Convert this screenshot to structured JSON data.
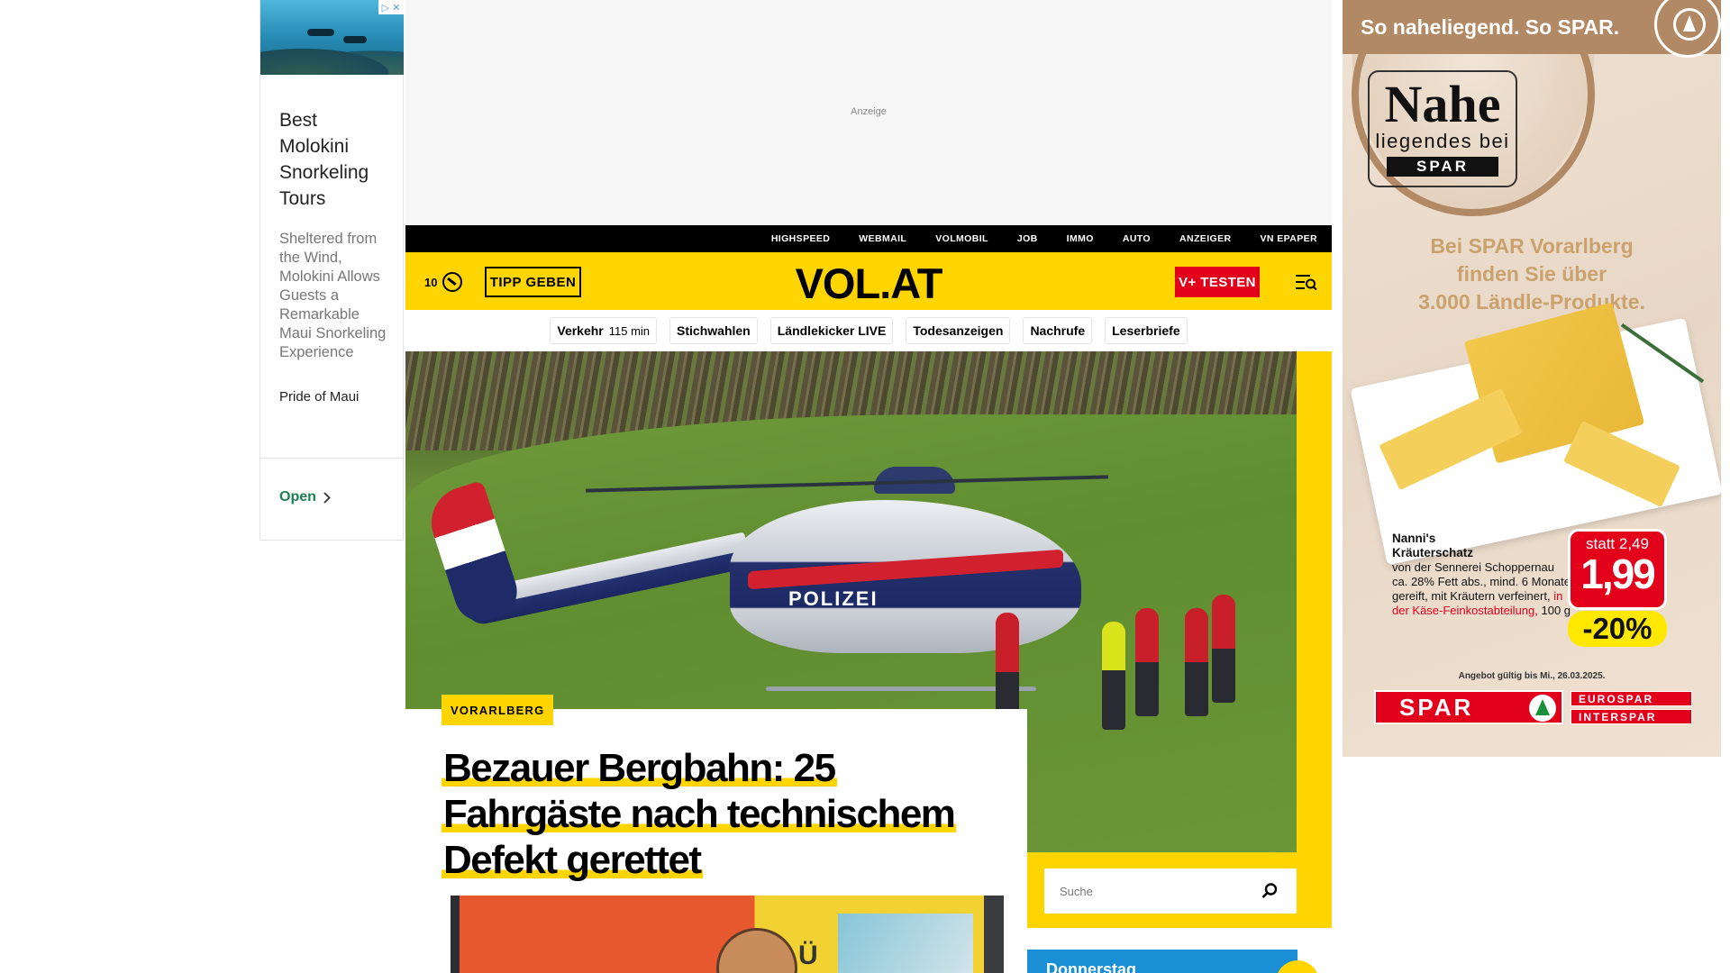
{
  "left_ad": {
    "title": "Best Molokini Snorkeling Tours",
    "description": "Sheltered from the Wind, Molokini Allows Guests a Remarkable Maui Snorkeling Experience",
    "brand": "Pride of Maui",
    "cta": "Open"
  },
  "top_ad": {
    "label": "Anzeige"
  },
  "top_links": [
    "HIGHSPEED",
    "WEBMAIL",
    "VOLMOBIL",
    "JOB",
    "IMMO",
    "AUTO",
    "ANZEIGER",
    "VN EPAPER"
  ],
  "header": {
    "counter": "10",
    "tipp_label": "TIPP GEBEN",
    "logo": "VOL.AT",
    "v_test_label": "V+ TESTEN"
  },
  "quicknav": {
    "traffic_label": "Verkehr",
    "traffic_minutes": "115 min",
    "items": [
      "Stichwahlen",
      "Ländlekicker LIVE",
      "Todesanzeigen",
      "Nachrufe",
      "Leserbriefe"
    ]
  },
  "hero": {
    "heli_text": "POLIZEI"
  },
  "article": {
    "kicker": "VORARLBERG",
    "headline": "Bezauer Bergbahn: 25 Fahrgäste nach technischem Defekt gerettet"
  },
  "search": {
    "placeholder": "Suche"
  },
  "weather": {
    "day": "Donnerstag"
  },
  "spar_ad": {
    "top_text": "So naheliegend. So SPAR.",
    "nahe_big": "Nahe",
    "nahe_small": "liegendes bei",
    "nahe_brand": "SPAR",
    "promo_line1": "Bei SPAR Vorarlberg",
    "promo_line2": "finden Sie über",
    "promo_line3": "3.000 Ländle-Produkte.",
    "product_name_1": "Nanni's",
    "product_name_2": "Kräuterschatz",
    "product_desc": "von der Sennerei Schoppernau ca. 28% Fett abs., mind. 6 Monate gereift, mit Kräutern verfeinert,",
    "product_red": "in der Käse-Feinkostabteilung,",
    "product_weight": "100 g",
    "statt": "statt 2,49",
    "price": "1,99",
    "discount": "-20%",
    "validity": "Angebot gültig bis Mi., 26.03.2025.",
    "logo_main": "SPAR",
    "logo_sub1": "EUROSPAR",
    "logo_sub2": "INTERSPAR"
  }
}
